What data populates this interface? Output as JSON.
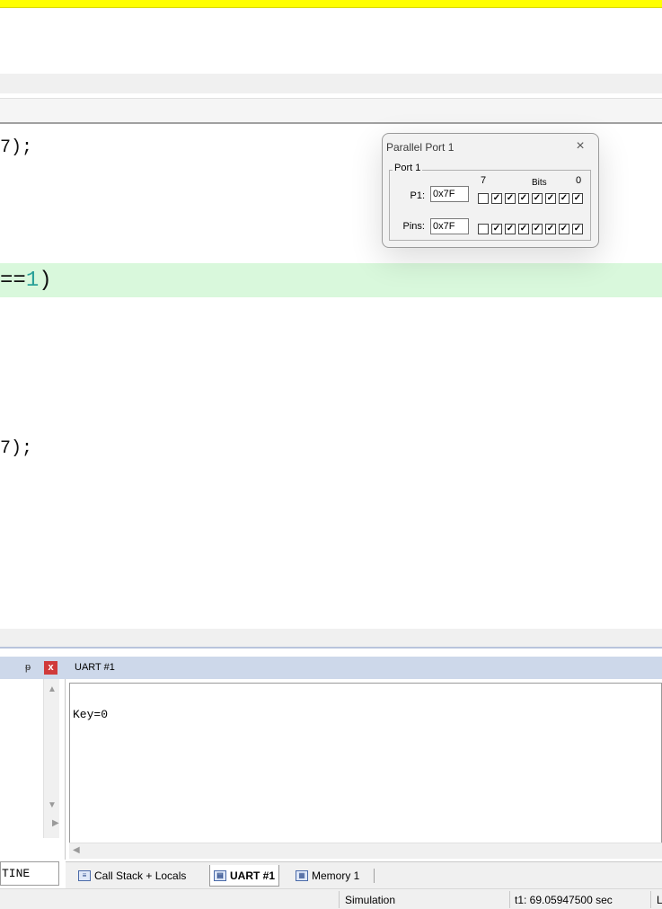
{
  "editor": {
    "line1": "7);",
    "line2_op": "==",
    "line2_num": "1",
    "line2_close": ")",
    "line3": "7);"
  },
  "parallel_port": {
    "title": "Parallel Port 1",
    "close": "×",
    "group_label": "Port 1",
    "bit_high": "7",
    "bits_label": "Bits",
    "bit_low": "0",
    "p1_label": "P1:",
    "p1_value": "0x7F",
    "pins_label": "Pins:",
    "pins_value": "0x7F",
    "p1_bits": [
      false,
      true,
      true,
      true,
      true,
      true,
      true,
      true
    ],
    "pins_bits": [
      false,
      true,
      true,
      true,
      true,
      true,
      true,
      true
    ]
  },
  "left_panel": {
    "pin": "ᵽ",
    "close": "x",
    "bottom_text": "TINE"
  },
  "uart": {
    "title": "UART #1",
    "output": "Key=0"
  },
  "tabs": {
    "callstack": "Call Stack + Locals",
    "uart": "UART #1",
    "memory": "Memory 1"
  },
  "status": {
    "mode": "Simulation",
    "t1": "t1: 69.05947500 sec",
    "tail": "L"
  }
}
